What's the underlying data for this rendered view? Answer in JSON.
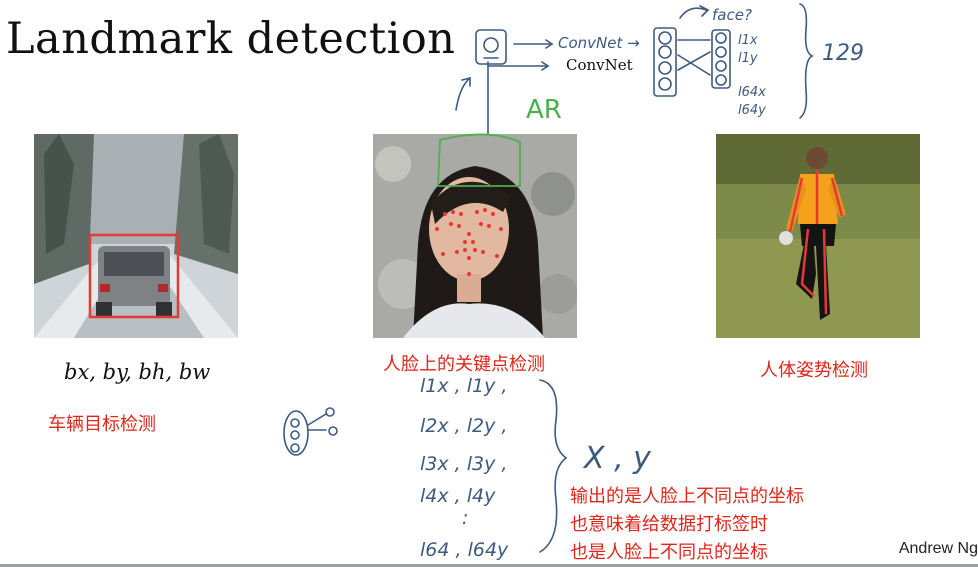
{
  "slide": {
    "title": "Landmark detection",
    "convnet_label": "ConvNet",
    "formula": "bx, by, bh, bw",
    "author": "Andrew Ng"
  },
  "annotations": {
    "car_caption": "车辆目标检测",
    "face_caption": "人脸上的关键点检测",
    "pose_caption": "人体姿势检测",
    "note_line1": "输出的是人脸上不同点的坐标",
    "note_line2": "也意味着给数据打标签时",
    "note_line3": "也是人脸上不同点的坐标"
  },
  "handwriting": {
    "convnet_scrawl": "ConvNet →",
    "face_question": "face?",
    "count": "129",
    "ar": "AR",
    "outputs": [
      "l1x",
      "l1y",
      "l64x",
      "l64y"
    ],
    "landmark_list": [
      "l1x , l1y ,",
      "l2x , l2y ,",
      "l3x , l3y ,",
      "l4x , l4y",
      ":",
      "l64 , l64y"
    ],
    "xy": "X , y"
  },
  "colors": {
    "annotation_red": "#e0261b",
    "ink_blue": "#3d5a80",
    "ink_green": "#4caf50"
  }
}
